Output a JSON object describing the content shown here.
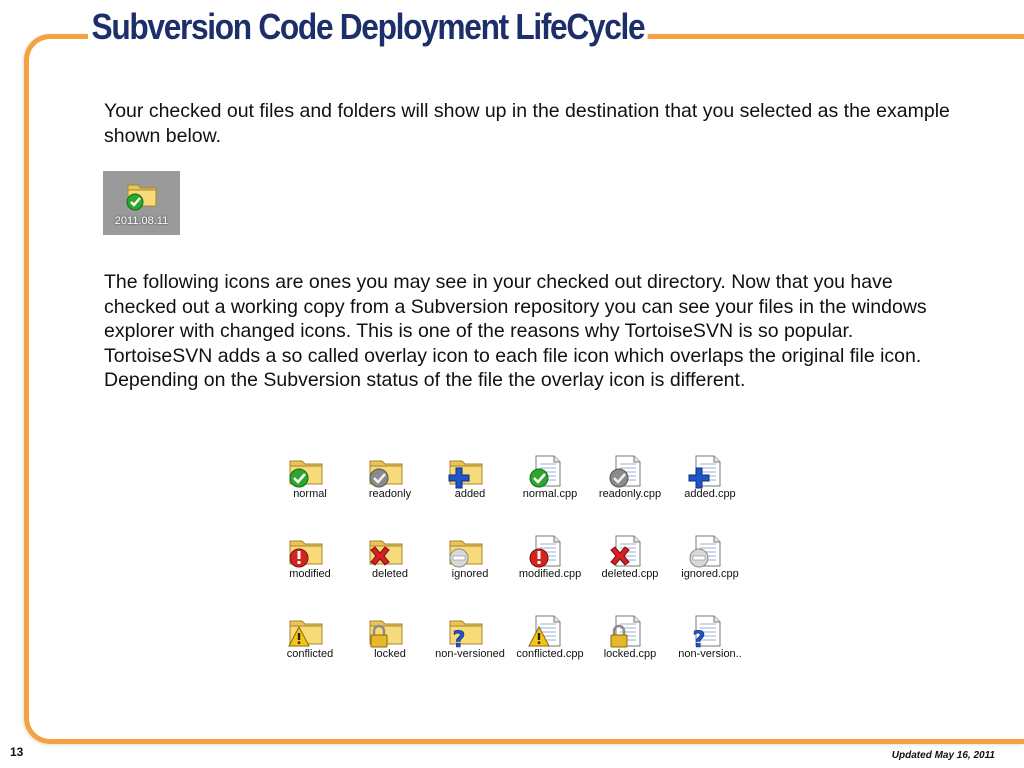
{
  "slide": {
    "title": "Subversion Code Deployment LifeCycle",
    "intro_text": "Your checked out files and folders will show up in the destination that you selected as the example shown below.",
    "sample_folder_label": "2011.08.11",
    "body_text": "The following icons are ones you may  see  in your checked out directory. Now that you have checked out a working copy from a Subversion repository you can see your files in the windows explorer with changed icons. This is one of the reasons why TortoiseSVN is so popular. TortoiseSVN adds a so called overlay icon to each file icon which overlaps the original file icon. Depending on the Subversion status of the file the overlay icon is different.",
    "page_number": "13",
    "updated": "Updated May 16, 2011"
  },
  "colors": {
    "frame": "#f4a340",
    "title": "#1d2f6b"
  },
  "icons": [
    {
      "label": "normal",
      "base": "folder",
      "overlay": "check"
    },
    {
      "label": "readonly",
      "base": "folder",
      "overlay": "readonly"
    },
    {
      "label": "added",
      "base": "folder",
      "overlay": "plus"
    },
    {
      "label": "normal.cpp",
      "base": "file",
      "overlay": "check"
    },
    {
      "label": "readonly.cpp",
      "base": "file",
      "overlay": "readonly"
    },
    {
      "label": "added.cpp",
      "base": "file",
      "overlay": "plus"
    },
    {
      "label": "modified",
      "base": "folder",
      "overlay": "modified"
    },
    {
      "label": "deleted",
      "base": "folder",
      "overlay": "deleted"
    },
    {
      "label": "ignored",
      "base": "folder",
      "overlay": "ignored"
    },
    {
      "label": "modified.cpp",
      "base": "file",
      "overlay": "modified"
    },
    {
      "label": "deleted.cpp",
      "base": "file",
      "overlay": "deleted"
    },
    {
      "label": "ignored.cpp",
      "base": "file",
      "overlay": "ignored"
    },
    {
      "label": "conflicted",
      "base": "folder",
      "overlay": "conflicted"
    },
    {
      "label": "locked",
      "base": "folder",
      "overlay": "locked"
    },
    {
      "label": "non-versioned",
      "base": "folder",
      "overlay": "unversioned"
    },
    {
      "label": "conflicted.cpp",
      "base": "file",
      "overlay": "conflicted"
    },
    {
      "label": "locked.cpp",
      "base": "file",
      "overlay": "locked"
    },
    {
      "label": "non-version..",
      "base": "file",
      "overlay": "unversioned"
    }
  ]
}
